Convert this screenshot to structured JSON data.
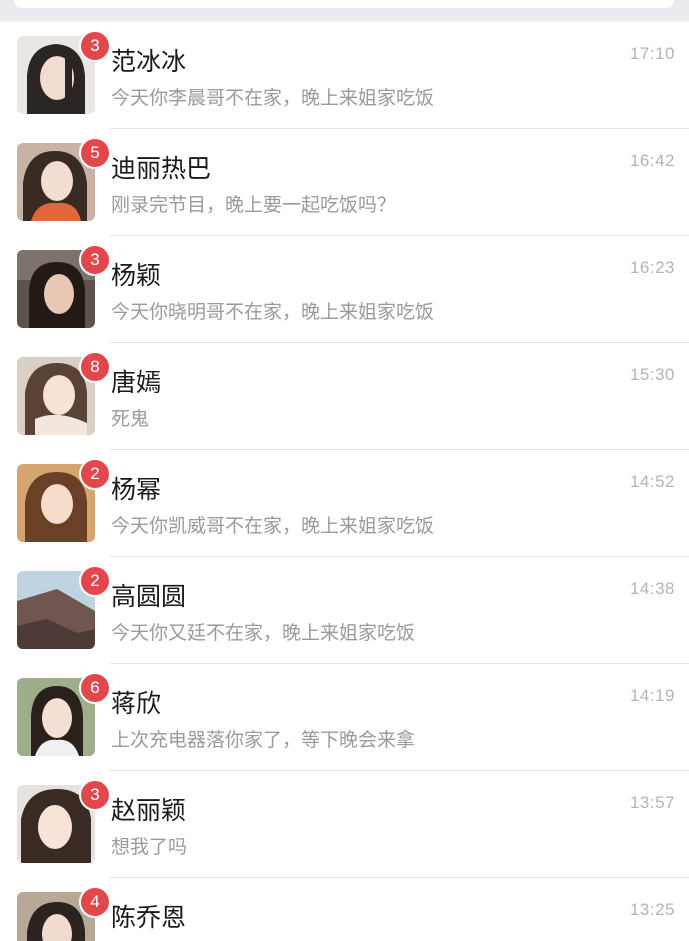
{
  "conversations": [
    {
      "name": "范冰冰",
      "preview": "今天你李晨哥不在家，晚上来姐家吃饭",
      "time": "17:10",
      "unread": "3"
    },
    {
      "name": "迪丽热巴",
      "preview": "刚录完节目，晚上要一起吃饭吗？",
      "time": "16:42",
      "unread": "5"
    },
    {
      "name": "杨颖",
      "preview": "今天你晓明哥不在家，晚上来姐家吃饭",
      "time": "16:23",
      "unread": "3"
    },
    {
      "name": "唐嫣",
      "preview": "死鬼",
      "time": "15:30",
      "unread": "8"
    },
    {
      "name": "杨幂",
      "preview": "今天你凯威哥不在家，晚上来姐家吃饭",
      "time": "14:52",
      "unread": "2"
    },
    {
      "name": "高圆圆",
      "preview": "今天你又廷不在家，晚上来姐家吃饭",
      "time": "14:38",
      "unread": "2"
    },
    {
      "name": "蒋欣",
      "preview": "上次充电器落你家了，等下晚会来拿",
      "time": "14:19",
      "unread": "6"
    },
    {
      "name": "赵丽颖",
      "preview": "想我了吗",
      "time": "13:57",
      "unread": "3"
    },
    {
      "name": "陈乔恩",
      "preview": "",
      "time": "13:25",
      "unread": "4"
    }
  ],
  "colors": {
    "badge": "#e2474b",
    "name": "#1a1a1a",
    "preview": "#9a9a9a",
    "time": "#b4b4b4",
    "divider": "#e4e4e4"
  },
  "icons": {
    "avatar": "contact-photo"
  }
}
